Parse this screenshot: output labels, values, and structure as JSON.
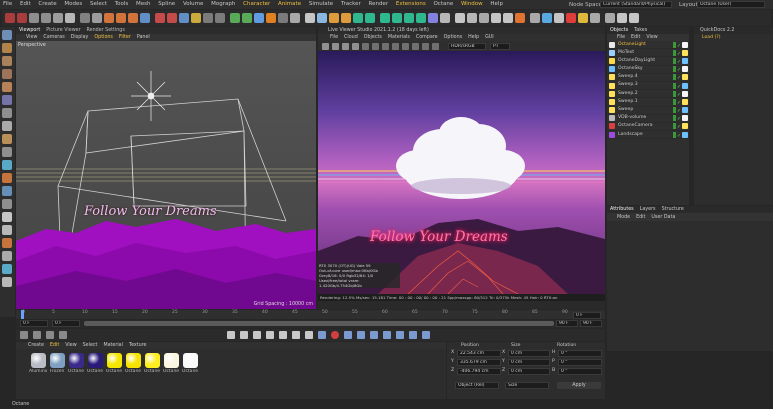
{
  "menu": [
    "File",
    "Edit",
    "Create",
    "Modes",
    "Select",
    "Tools",
    "Mesh",
    "Spline",
    "Volume",
    "Mograph",
    "Character",
    "Animate",
    "Simulate",
    "Tracker",
    "Render",
    "Extensions",
    "Octane",
    "Window",
    "Help"
  ],
  "node_space": {
    "label": "Node Space:",
    "value": "Current (Standard/Physical)"
  },
  "layout": {
    "label": "Layout:",
    "value": "Octane (User)"
  },
  "viewport": {
    "title": "Viewport",
    "tabs": [
      "Picture Viewer",
      "Render Settings"
    ],
    "menu": [
      "View",
      "Cameras",
      "Display",
      "Options",
      "Filter",
      "Panel"
    ],
    "label": "Perspective",
    "grid": "Grid Spacing : 10000 cm",
    "text": "Follow Your Dreams"
  },
  "live_viewer": {
    "title": "Live Viewer Studio 2021.1.2 (18 days left)",
    "menu": [
      "File",
      "Cloud",
      "Objects",
      "Materials",
      "Compare",
      "Options",
      "Help",
      "GUI"
    ],
    "mode": "HDR/sRGB",
    "pt": "PT",
    "text": "Follow Your Dreams",
    "stats": [
      "RTX 3070 (OT)(UG)    Vale    59",
      "Out-of-core used/max:0Kb/0Gb",
      "Grey8/16: 0/0        Rgb32/64: 1/0",
      "Used/free/total vram: 1.420Gb/4.754Gb/8Gb"
    ],
    "status": "Rendering: 12.5%   Ms/sec: 15.181   Time: 00 : 00 : 00/ 00 : 00 : 21   Spp/maxspp: 80/512   Tri: 0/375k   Mesh: 45   Hair: 0   RTX:on"
  },
  "objects": {
    "tabs": [
      "Objects",
      "Takes"
    ],
    "menu": [
      "File",
      "Edit",
      "View"
    ],
    "items": [
      {
        "name": "OctaneLight",
        "color": "#e8e8e8",
        "sel": true
      },
      {
        "name": "MoText",
        "color": "#9ad0ff"
      },
      {
        "name": "OctaneDayLight",
        "color": "#ffd94a"
      },
      {
        "name": "OctaneSky",
        "color": "#6ec0ff"
      },
      {
        "name": "Sweep.4",
        "color": "#ffe25a"
      },
      {
        "name": "Sweep.3",
        "color": "#ffe25a"
      },
      {
        "name": "Sweep.2",
        "color": "#ffe25a"
      },
      {
        "name": "Sweep.1",
        "color": "#ffe25a"
      },
      {
        "name": "Sweep",
        "color": "#ffe25a"
      },
      {
        "name": "VDB-volume",
        "color": "#bbbbbb"
      },
      {
        "name": "OctaneCamera",
        "color": "#d94040"
      },
      {
        "name": "Landscape",
        "color": "#9b4de0"
      }
    ]
  },
  "quickdoc": {
    "title": "QuickDocs 2.2",
    "item": "Load (?)"
  },
  "attributes": {
    "tabs": [
      "Attributes",
      "Layers",
      "Structure"
    ],
    "menu": [
      "Mode",
      "Edit",
      "User Data"
    ]
  },
  "timeline": {
    "ticks": [
      "0",
      "5",
      "10",
      "15",
      "20",
      "25",
      "30",
      "35",
      "40",
      "45",
      "50",
      "55",
      "60",
      "65",
      "70",
      "75",
      "80",
      "85",
      "90"
    ],
    "frame_start": "0 F",
    "frame_cur": "0 F",
    "frame_end": "90 F",
    "frame_max": "90 F",
    "frame_right": "0 F"
  },
  "material_manager": {
    "menu": [
      "Create",
      "Edit",
      "View",
      "Select",
      "Material",
      "Texture"
    ],
    "materials": [
      {
        "name": "Aluminiu",
        "color": "#b8bcc4"
      },
      {
        "name": "Frozen",
        "color": "#7fa0c0"
      },
      {
        "name": "Octane",
        "color": "#3a2a8a"
      },
      {
        "name": "Octane",
        "color": "#2a1a7a"
      },
      {
        "name": "Octane",
        "color": "#f5e600"
      },
      {
        "name": "Octane",
        "color": "#f7e300"
      },
      {
        "name": "Octane",
        "color": "#ffee20"
      },
      {
        "name": "Octane",
        "color": "#fbf6e0"
      },
      {
        "name": "Octane",
        "color": "#fafafa"
      }
    ]
  },
  "coords": {
    "headers": [
      "Position",
      "Size",
      "Rotation"
    ],
    "rows": [
      {
        "axis": "X",
        "pos": "22.543 cm",
        "size": "0 cm",
        "rotlab": "H",
        "rot": "0 °"
      },
      {
        "axis": "Y",
        "pos": "335.679 cm",
        "size": "0 cm",
        "rotlab": "P",
        "rot": "0 °"
      },
      {
        "axis": "Z",
        "pos": "-406.794 cm",
        "size": "0 cm",
        "rotlab": "B",
        "rot": "0 °"
      }
    ],
    "mode": "Object (Rel)",
    "sizemode": "Size",
    "apply": "Apply"
  },
  "status_bar": "Octane",
  "colors": {
    "accent": "#f0c040",
    "purple": "#b020c0",
    "sky": "#c060d0"
  }
}
